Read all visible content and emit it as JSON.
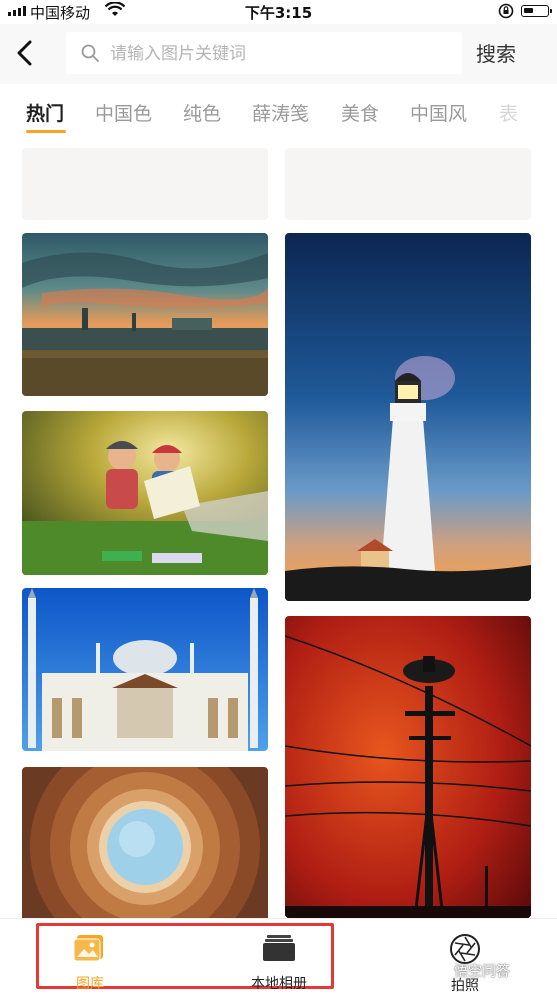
{
  "status_bar": {
    "carrier": "中国移动",
    "time": "下午3:15"
  },
  "header": {
    "search_placeholder": "请输入图片关键词",
    "search_button": "搜索"
  },
  "tabs": [
    {
      "label": "热门",
      "active": true
    },
    {
      "label": "中国色"
    },
    {
      "label": "纯色"
    },
    {
      "label": "薛涛笺"
    },
    {
      "label": "美食"
    },
    {
      "label": "中国风"
    },
    {
      "label": "表"
    }
  ],
  "grid": {
    "images": [
      "sunset-factory",
      "children-reading",
      "mosque",
      "lighthouse",
      "circular-ceiling",
      "power-pole-red-sky"
    ]
  },
  "bottom_nav": {
    "gallery": "图库",
    "local_album": "本地相册",
    "camera": "拍照"
  },
  "watermark": "悟空问答",
  "colors": {
    "accent": "#f5a623",
    "highlight": "#e53935"
  }
}
